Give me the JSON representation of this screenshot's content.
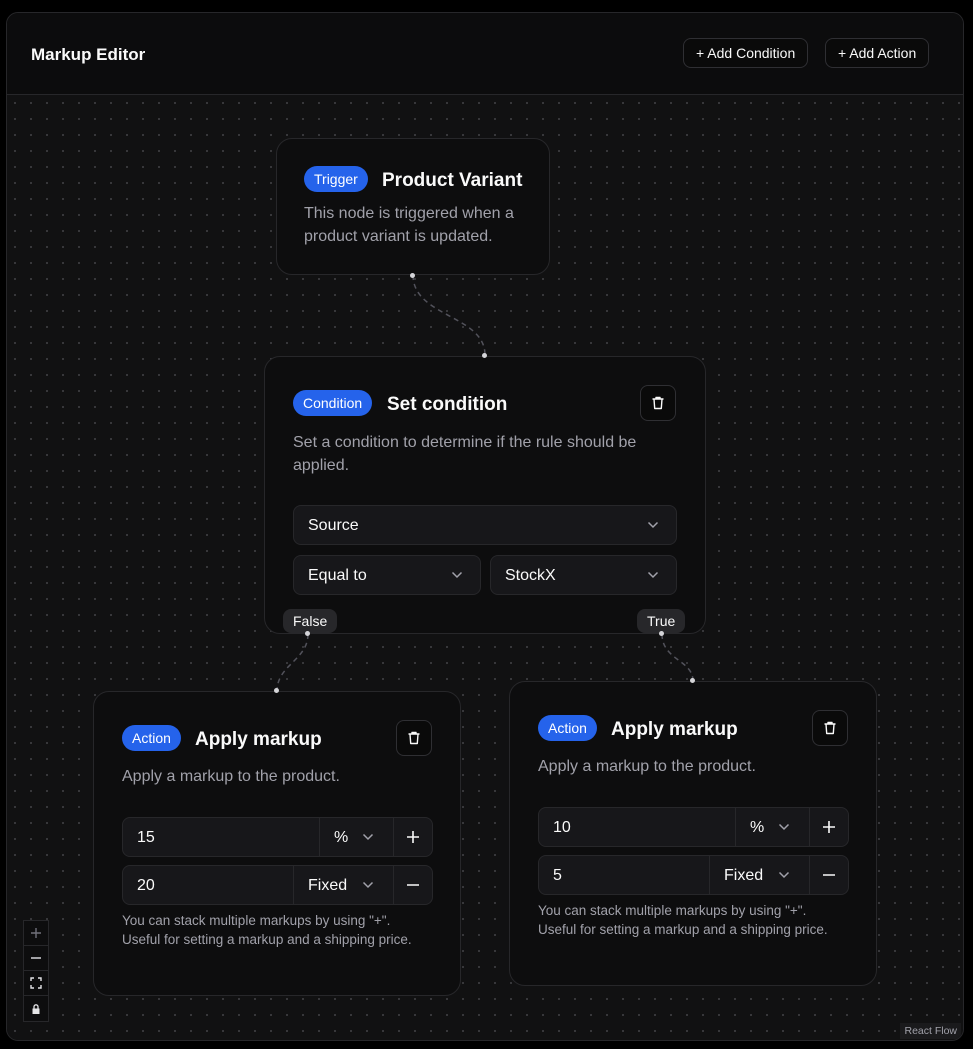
{
  "header": {
    "title": "Markup Editor",
    "add_condition_label": "+ Add Condition",
    "add_action_label": "+ Add Action"
  },
  "trigger_node": {
    "badge": "Trigger",
    "title": "Product Variant",
    "description": "This node is triggered when a product variant is updated."
  },
  "condition_node": {
    "badge": "Condition",
    "title": "Set condition",
    "description": "Set a condition to determine if the rule should be applied.",
    "field_select": "Source",
    "operator_select": "Equal to",
    "value_select": "StockX",
    "false_handle": "False",
    "true_handle": "True"
  },
  "action_left": {
    "badge": "Action",
    "title": "Apply markup",
    "description": "Apply a markup to the product.",
    "rows": [
      {
        "value": "15",
        "unit": "%",
        "button": "plus"
      },
      {
        "value": "20",
        "unit": "Fixed",
        "button": "minus"
      }
    ],
    "hint": "You can stack multiple markups by using \"+\". Useful for setting a markup and a shipping price."
  },
  "action_right": {
    "badge": "Action",
    "title": "Apply markup",
    "description": "Apply a markup to the product.",
    "rows": [
      {
        "value": "10",
        "unit": "%",
        "button": "plus"
      },
      {
        "value": "5",
        "unit": "Fixed",
        "button": "minus"
      }
    ],
    "hint": "You can stack multiple markups by using \"+\". Useful for setting a markup and a shipping price."
  },
  "controls": [
    "zoom-in",
    "zoom-out",
    "fit-view",
    "lock"
  ],
  "attribution": "React Flow",
  "colors": {
    "accent": "#2563eb",
    "background": "#0a0a0a",
    "border": "#27272a",
    "muted_text": "#a1a1aa"
  }
}
